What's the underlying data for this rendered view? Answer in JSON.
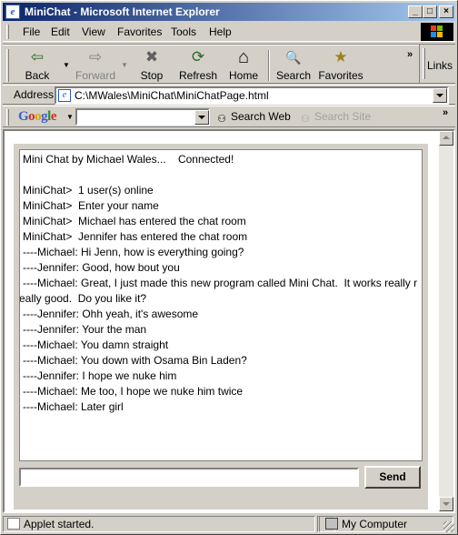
{
  "window": {
    "title": "MiniChat - Microsoft Internet Explorer",
    "title_controls": {
      "minimize": "_",
      "maximize": "□",
      "close": "×"
    }
  },
  "menu": {
    "items": [
      "File",
      "Edit",
      "View",
      "Favorites",
      "Tools",
      "Help"
    ]
  },
  "toolbar": {
    "buttons": [
      {
        "label": "Back",
        "icon": "back-arrow-icon",
        "glyph": "⇦",
        "enabled": true
      },
      {
        "label": "Forward",
        "icon": "forward-arrow-icon",
        "glyph": "⇨",
        "enabled": false
      },
      {
        "label": "Stop",
        "icon": "stop-icon",
        "glyph": "✖",
        "enabled": true
      },
      {
        "label": "Refresh",
        "icon": "refresh-icon",
        "glyph": "⟳",
        "enabled": true
      },
      {
        "label": "Home",
        "icon": "home-icon",
        "glyph": "⌂",
        "enabled": true
      },
      {
        "label": "Search",
        "icon": "search-icon",
        "glyph": "🔍",
        "enabled": true
      },
      {
        "label": "Favorites",
        "icon": "favorites-icon",
        "glyph": "★",
        "enabled": true
      }
    ],
    "links_label": "Links"
  },
  "address": {
    "label": "Address",
    "url": "C:\\MWales\\MiniChat\\MiniChatPage.html"
  },
  "google_bar": {
    "logo_letters": [
      "G",
      "o",
      "o",
      "g",
      "l",
      "e"
    ],
    "logo_colors": [
      "#3a5fcd",
      "#d03020",
      "#e0a000",
      "#3a5fcd",
      "#209030",
      "#d03020"
    ],
    "search_value": "",
    "search_web_label": "Search Web",
    "search_site_label": "Search Site"
  },
  "chat": {
    "lines": [
      "Mini Chat by Michael Wales...    Connected!",
      "",
      "MiniChat>  1 user(s) online",
      "MiniChat>  Enter your name",
      "MiniChat>  Michael has entered the chat room",
      "MiniChat>  Jennifer has entered the chat room",
      "----Michael: Hi Jenn, how is everything going?",
      "----Jennifer: Good, how bout you",
      "----Michael: Great, I just made this new program called Mini Chat.  It works really r",
      "eally good.  Do you like it?",
      "----Jennifer: Ohh yeah, it's awesome",
      "----Jennifer: Your the man",
      "----Michael: You damn straight",
      "----Michael: You down with Osama Bin Laden?",
      "----Jennifer: I hope we nuke him",
      "----Michael: Me too, I hope we nuke him twice",
      "----Michael: Later girl"
    ],
    "input_value": "",
    "send_label": "Send"
  },
  "status": {
    "text": "Applet started.",
    "zone": "My Computer"
  },
  "colors": {
    "title_gradient_start": "#0a246a",
    "title_gradient_end": "#a6caf0",
    "chrome": "#d4d0c8"
  }
}
